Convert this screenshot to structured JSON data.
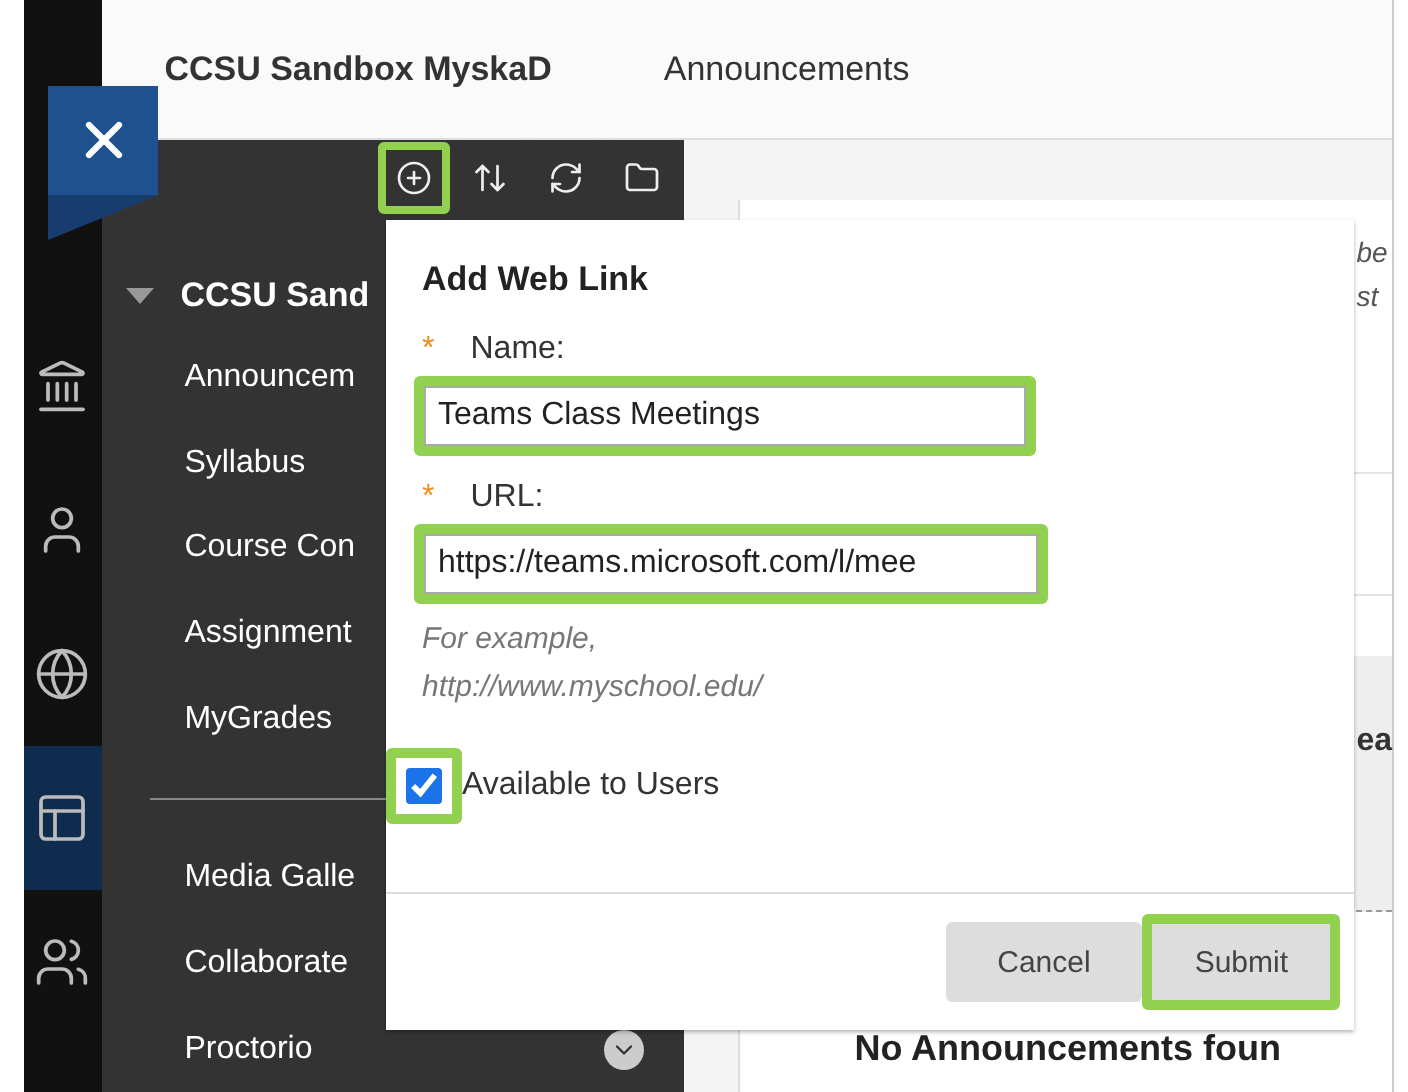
{
  "header": {
    "course": "CCSU Sandbox MyskaD",
    "page": "Announcements"
  },
  "rail": [
    {
      "selected": false
    },
    {
      "selected": false
    },
    {
      "selected": false
    },
    {
      "selected": true
    },
    {
      "selected": false
    }
  ],
  "toolbar": [
    {
      "highlighted": true
    },
    {
      "highlighted": false
    },
    {
      "highlighted": false
    },
    {
      "highlighted": false
    }
  ],
  "course_menu": {
    "title": "CCSU Sand",
    "expanded": true,
    "items": [
      {
        "kind": "link",
        "label": "Announcem"
      },
      {
        "kind": "link",
        "label": "Syllabus"
      },
      {
        "kind": "link",
        "label": "Course Con"
      },
      {
        "kind": "link",
        "label": "Assignment"
      },
      {
        "kind": "link",
        "label": "MyGrades"
      },
      {
        "kind": "divider"
      },
      {
        "kind": "link",
        "label": "Media Galle"
      },
      {
        "kind": "link",
        "label": "Collaborate"
      },
      {
        "kind": "submenu",
        "label": "Proctorio"
      }
    ]
  },
  "background": {
    "notes": [
      "be",
      "st"
    ],
    "section_heading": "ea",
    "empty_message": "No Announcements foun"
  },
  "dialog": {
    "title": "Add Web Link",
    "fields": [
      {
        "required_mark": "*",
        "label": "Name:",
        "value": "Teams Class Meetings",
        "highlighted": true
      },
      {
        "required_mark": "*",
        "label": "URL:",
        "value": "https://teams.microsoft.com/l/mee",
        "highlighted": true,
        "hint": "For example,\nhttp://www.myschool.edu/"
      }
    ],
    "available": {
      "label": "Available to Users",
      "checked": true,
      "highlighted": true
    },
    "buttons": [
      {
        "label": "Cancel",
        "highlighted": false
      },
      {
        "label": "Submit",
        "highlighted": true
      }
    ]
  }
}
